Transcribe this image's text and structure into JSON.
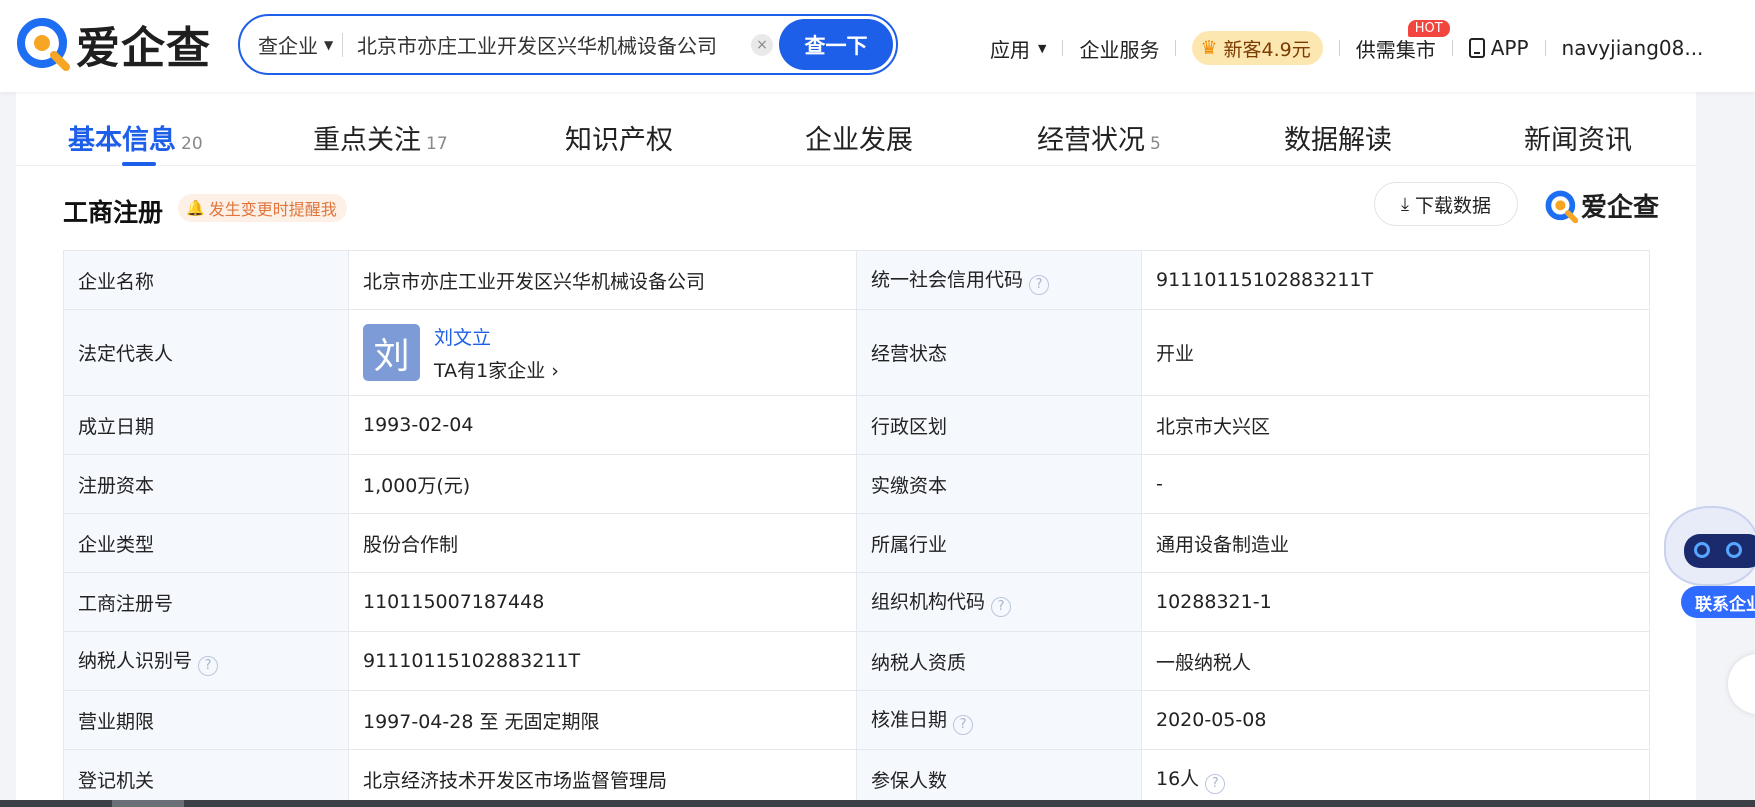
{
  "header": {
    "logo_text": "爱企查",
    "search": {
      "type_label": "查企业",
      "query": "北京市亦庄工业开发区兴华机械设备公司",
      "clear_label": "×",
      "button_label": "查一下"
    },
    "nav": {
      "apps": "应用",
      "enterprise_service": "企业服务",
      "promo": "新客4.9元",
      "market": "供需集市",
      "hot_badge": "HOT",
      "app": "APP",
      "user": "navyjiang08..."
    }
  },
  "tabs": [
    {
      "label": "基本信息",
      "count": "20"
    },
    {
      "label": "重点关注",
      "count": "17"
    },
    {
      "label": "知识产权",
      "count": ""
    },
    {
      "label": "企业发展",
      "count": ""
    },
    {
      "label": "经营状况",
      "count": "5"
    },
    {
      "label": "数据解读",
      "count": ""
    },
    {
      "label": "新闻资讯",
      "count": ""
    }
  ],
  "section": {
    "title": "工商注册",
    "remind": "发生变更时提醒我",
    "download": "下载数据",
    "brand": "爱企查"
  },
  "table": {
    "company_name_label": "企业名称",
    "company_name": "北京市亦庄工业开发区兴华机械设备公司",
    "credit_code_label": "统一社会信用代码",
    "credit_code": "91110115102883211T",
    "legal_rep_label": "法定代表人",
    "legal_rep_avatar": "刘",
    "legal_rep_name": "刘文立",
    "legal_rep_companies": "TA有1家企业",
    "status_label": "经营状态",
    "status": "开业",
    "founded_label": "成立日期",
    "founded": "1993-02-04",
    "region_label": "行政区划",
    "region": "北京市大兴区",
    "reg_capital_label": "注册资本",
    "reg_capital": "1,000万(元)",
    "paid_capital_label": "实缴资本",
    "paid_capital": "-",
    "type_label": "企业类型",
    "type": "股份合作制",
    "industry_label": "所属行业",
    "industry": "通用设备制造业",
    "reg_no_label": "工商注册号",
    "reg_no": "110115007187448",
    "org_code_label": "组织机构代码",
    "org_code": "10288321-1",
    "taxpayer_id_label": "纳税人识别号",
    "taxpayer_id": "91110115102883211T",
    "taxpayer_quality_label": "纳税人资质",
    "taxpayer_quality": "一般纳税人",
    "term_label": "营业期限",
    "term": "1997-04-28 至 无固定期限",
    "approval_label": "核准日期",
    "approval": "2020-05-08",
    "authority_label": "登记机关",
    "authority": "北京经济技术开发区市场监督管理局",
    "insured_label": "参保人数",
    "insured": "16人"
  },
  "assistant": {
    "contact_label": "联系企业"
  },
  "colors": {
    "accent": "#1d5fe8",
    "label_bg": "#f5f8fd",
    "remind_text": "#e0763d",
    "hot": "#f2453d"
  }
}
